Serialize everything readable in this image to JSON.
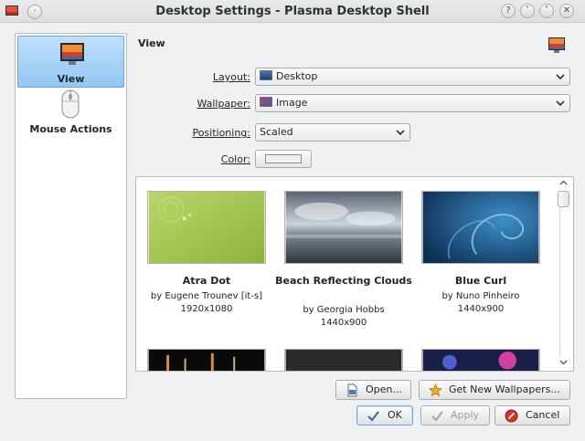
{
  "window": {
    "title": "Desktop Settings - Plasma Desktop Shell",
    "buttons": {
      "help": "?",
      "minimize": "˅",
      "maximize": "˄",
      "close": "✕"
    }
  },
  "sidebar": {
    "items": [
      {
        "label": "View",
        "icon": "desktop-view-icon",
        "selected": true
      },
      {
        "label": "Mouse Actions",
        "icon": "mouse-icon",
        "selected": false
      }
    ]
  },
  "header": {
    "title": "View"
  },
  "form": {
    "layout": {
      "label": "Layout:",
      "value": "Desktop"
    },
    "wallpaper": {
      "label": "Wallpaper:",
      "value": "Image"
    },
    "positioning": {
      "label": "Positioning:",
      "value": "Scaled"
    },
    "color": {
      "label": "Color:",
      "value": "#f0f0f0"
    }
  },
  "wallpapers": [
    {
      "name": "Atra Dot",
      "author": "by Eugene Trounev [it-s]",
      "resolution": "1920x1080"
    },
    {
      "name": "Beach Reflecting Clouds",
      "author": "by Georgia Hobbs",
      "resolution": "1440x900"
    },
    {
      "name": "Blue Curl",
      "author": "by Nuno Pinheiro",
      "resolution": "1440x900"
    }
  ],
  "actions": {
    "open": "Open...",
    "get_new": "Get New Wallpapers...",
    "ok": "OK",
    "apply": "Apply",
    "cancel": "Cancel"
  },
  "colors": {
    "selection": "#93c6f3",
    "accent": "#3daee9",
    "window_bg": "#eff0f1"
  }
}
